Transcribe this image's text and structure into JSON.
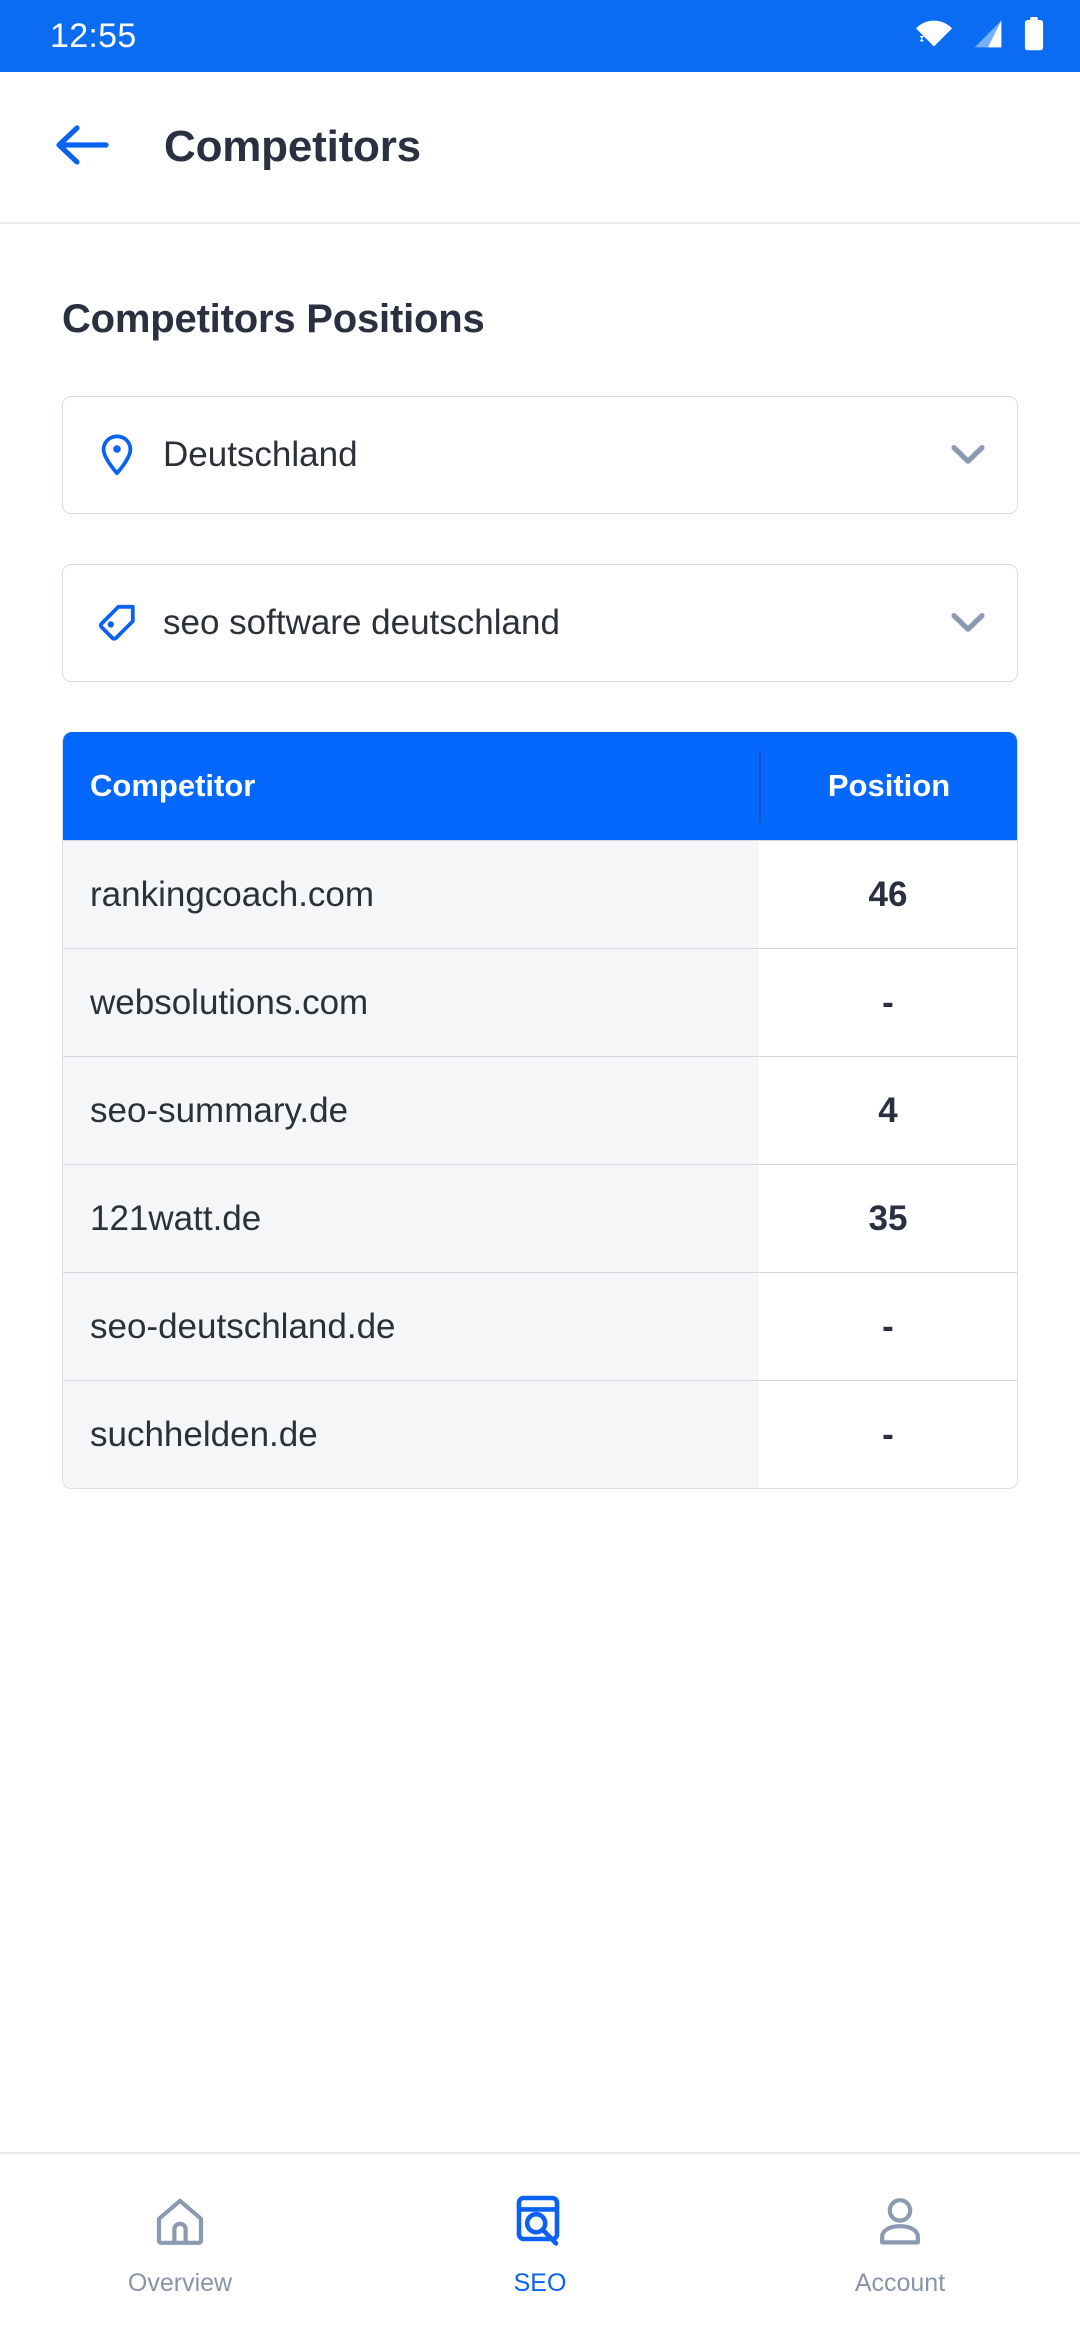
{
  "status_bar": {
    "time": "12:55",
    "icons": [
      "wifi-icon",
      "cellular-signal-icon",
      "battery-icon"
    ],
    "background_color": "#0A6CF1"
  },
  "app_bar": {
    "back_icon": "arrow-left-icon",
    "title": "Competitors",
    "title_color": "#2A3040",
    "back_icon_color": "#0B62F0"
  },
  "page": {
    "title": "Competitors Positions"
  },
  "filters": [
    {
      "icon": "map-pin-icon",
      "value": "Deutschland",
      "chevron": "chevron-down-icon",
      "icon_color": "#0B62F0"
    },
    {
      "icon": "tag-icon",
      "value": "seo software deutschland",
      "chevron": "chevron-down-icon",
      "icon_color": "#0B62F0"
    }
  ],
  "table": {
    "header_color": "#0568FE",
    "columns": [
      "Competitor",
      "Position"
    ],
    "rows": [
      {
        "competitor": "rankingcoach.com",
        "position": "46"
      },
      {
        "competitor": "websolutions.com",
        "position": "-"
      },
      {
        "competitor": "seo-summary.de",
        "position": "4"
      },
      {
        "competitor": "121watt.de",
        "position": "35"
      },
      {
        "competitor": "seo-deutschland.de",
        "position": "-"
      },
      {
        "competitor": "suchhelden.de",
        "position": "-"
      }
    ]
  },
  "bottom_nav": {
    "active_color": "#0B62F0",
    "inactive_color": "#8A94A6",
    "items": [
      {
        "icon": "home-icon",
        "label": "Overview",
        "active": false
      },
      {
        "icon": "seo-search-icon",
        "label": "SEO",
        "active": true
      },
      {
        "icon": "person-icon",
        "label": "Account",
        "active": false
      }
    ]
  }
}
